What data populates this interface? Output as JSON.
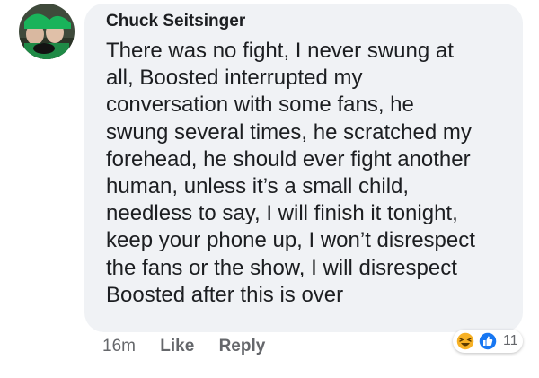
{
  "comment": {
    "author": "Chuck Seitsinger",
    "text_lines": [
      "There was no fight, I never swung at",
      "all, Boosted interrupted my",
      "conversation with some fans, he",
      "swung several times, he scratched my",
      "forehead, he should ever fight another",
      "human, unless it’s a small child,",
      "needless to say, I will finish it tonight,",
      "keep your phone up, I won’t disrespect",
      "the fans or the show, I will disrespect",
      "Boosted after this is over"
    ],
    "timestamp": "16m",
    "like_label": "Like",
    "reply_label": "Reply",
    "reaction_count": "11",
    "reactions": [
      "haha-icon",
      "like-icon"
    ]
  },
  "colors": {
    "bubble": "#f0f2f5",
    "text": "#1c1e21",
    "secondary": "#65676b",
    "like_blue": "#1877f2",
    "haha_yellow": "#f7b125"
  }
}
